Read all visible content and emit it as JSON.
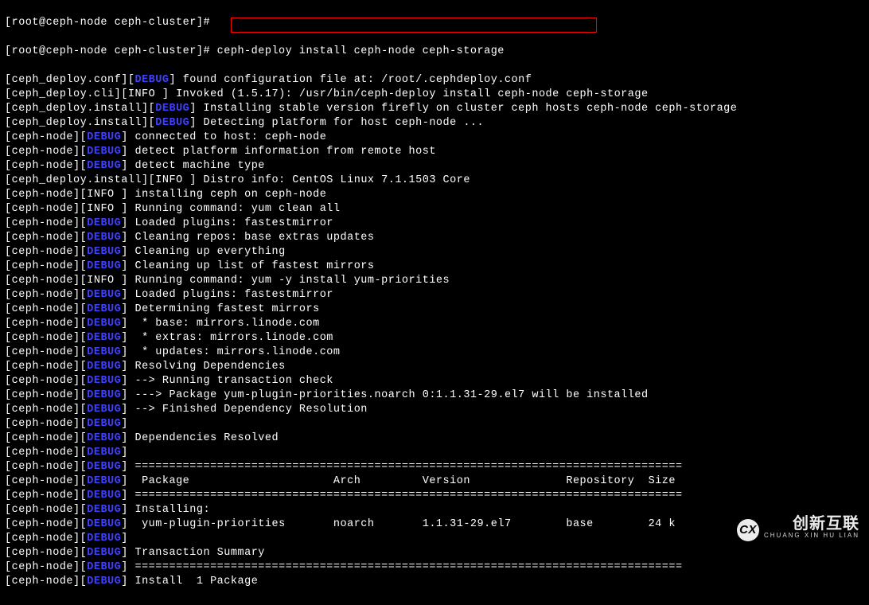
{
  "prompt1": "[root@ceph-node ceph-cluster]# ",
  "prompt2": "[root@ceph-node ceph-cluster]# ceph-deploy install ceph-node ceph-storage",
  "lines": [
    {
      "src": "ceph_deploy.conf",
      "lvl": "DEBUG",
      "msg": "found configuration file at: /root/.cephdeploy.conf"
    },
    {
      "src": "ceph_deploy.cli",
      "lvl": "INFO",
      "msg": "Invoked (1.5.17): /usr/bin/ceph-deploy install ceph-node ceph-storage"
    },
    {
      "src": "ceph_deploy.install",
      "lvl": "DEBUG",
      "msg": "Installing stable version firefly on cluster ceph hosts ceph-node ceph-storage"
    },
    {
      "src": "ceph_deploy.install",
      "lvl": "DEBUG",
      "msg": "Detecting platform for host ceph-node ..."
    },
    {
      "src": "ceph-node",
      "lvl": "DEBUG",
      "msg": "connected to host: ceph-node"
    },
    {
      "src": "ceph-node",
      "lvl": "DEBUG",
      "msg": "detect platform information from remote host"
    },
    {
      "src": "ceph-node",
      "lvl": "DEBUG",
      "msg": "detect machine type"
    },
    {
      "src": "ceph_deploy.install",
      "lvl": "INFO",
      "msg": "Distro info: CentOS Linux 7.1.1503 Core"
    },
    {
      "src": "ceph-node",
      "lvl": "INFO",
      "msg": "installing ceph on ceph-node"
    },
    {
      "src": "ceph-node",
      "lvl": "INFO",
      "msg": "Running command: yum clean all"
    },
    {
      "src": "ceph-node",
      "lvl": "DEBUG",
      "msg": "Loaded plugins: fastestmirror"
    },
    {
      "src": "ceph-node",
      "lvl": "DEBUG",
      "msg": "Cleaning repos: base extras updates"
    },
    {
      "src": "ceph-node",
      "lvl": "DEBUG",
      "msg": "Cleaning up everything"
    },
    {
      "src": "ceph-node",
      "lvl": "DEBUG",
      "msg": "Cleaning up list of fastest mirrors"
    },
    {
      "src": "ceph-node",
      "lvl": "INFO",
      "msg": "Running command: yum -y install yum-priorities"
    },
    {
      "src": "ceph-node",
      "lvl": "DEBUG",
      "msg": "Loaded plugins: fastestmirror"
    },
    {
      "src": "ceph-node",
      "lvl": "DEBUG",
      "msg": "Determining fastest mirrors"
    },
    {
      "src": "ceph-node",
      "lvl": "DEBUG",
      "msg": " * base: mirrors.linode.com"
    },
    {
      "src": "ceph-node",
      "lvl": "DEBUG",
      "msg": " * extras: mirrors.linode.com"
    },
    {
      "src": "ceph-node",
      "lvl": "DEBUG",
      "msg": " * updates: mirrors.linode.com"
    },
    {
      "src": "ceph-node",
      "lvl": "DEBUG",
      "msg": "Resolving Dependencies"
    },
    {
      "src": "ceph-node",
      "lvl": "DEBUG",
      "msg": "--> Running transaction check"
    },
    {
      "src": "ceph-node",
      "lvl": "DEBUG",
      "msg": "---> Package yum-plugin-priorities.noarch 0:1.1.31-29.el7 will be installed"
    },
    {
      "src": "ceph-node",
      "lvl": "DEBUG",
      "msg": "--> Finished Dependency Resolution"
    },
    {
      "src": "ceph-node",
      "lvl": "DEBUG",
      "msg": ""
    },
    {
      "src": "ceph-node",
      "lvl": "DEBUG",
      "msg": "Dependencies Resolved"
    },
    {
      "src": "ceph-node",
      "lvl": "DEBUG",
      "msg": ""
    },
    {
      "src": "ceph-node",
      "lvl": "DEBUG",
      "msg": "================================================================================"
    },
    {
      "src": "ceph-node",
      "lvl": "DEBUG",
      "msg": " Package                     Arch         Version              Repository  Size"
    },
    {
      "src": "ceph-node",
      "lvl": "DEBUG",
      "msg": "================================================================================"
    },
    {
      "src": "ceph-node",
      "lvl": "DEBUG",
      "msg": "Installing:"
    },
    {
      "src": "ceph-node",
      "lvl": "DEBUG",
      "msg": " yum-plugin-priorities       noarch       1.1.31-29.el7        base        24 k"
    },
    {
      "src": "ceph-node",
      "lvl": "DEBUG",
      "msg": ""
    },
    {
      "src": "ceph-node",
      "lvl": "DEBUG",
      "msg": "Transaction Summary"
    },
    {
      "src": "ceph-node",
      "lvl": "DEBUG",
      "msg": "================================================================================"
    },
    {
      "src": "ceph-node",
      "lvl": "DEBUG",
      "msg": "Install  1 Package"
    }
  ],
  "watermark": {
    "brand": "创新互联",
    "sub": "CHUANG XIN HU LIAN",
    "cx": "CX"
  }
}
